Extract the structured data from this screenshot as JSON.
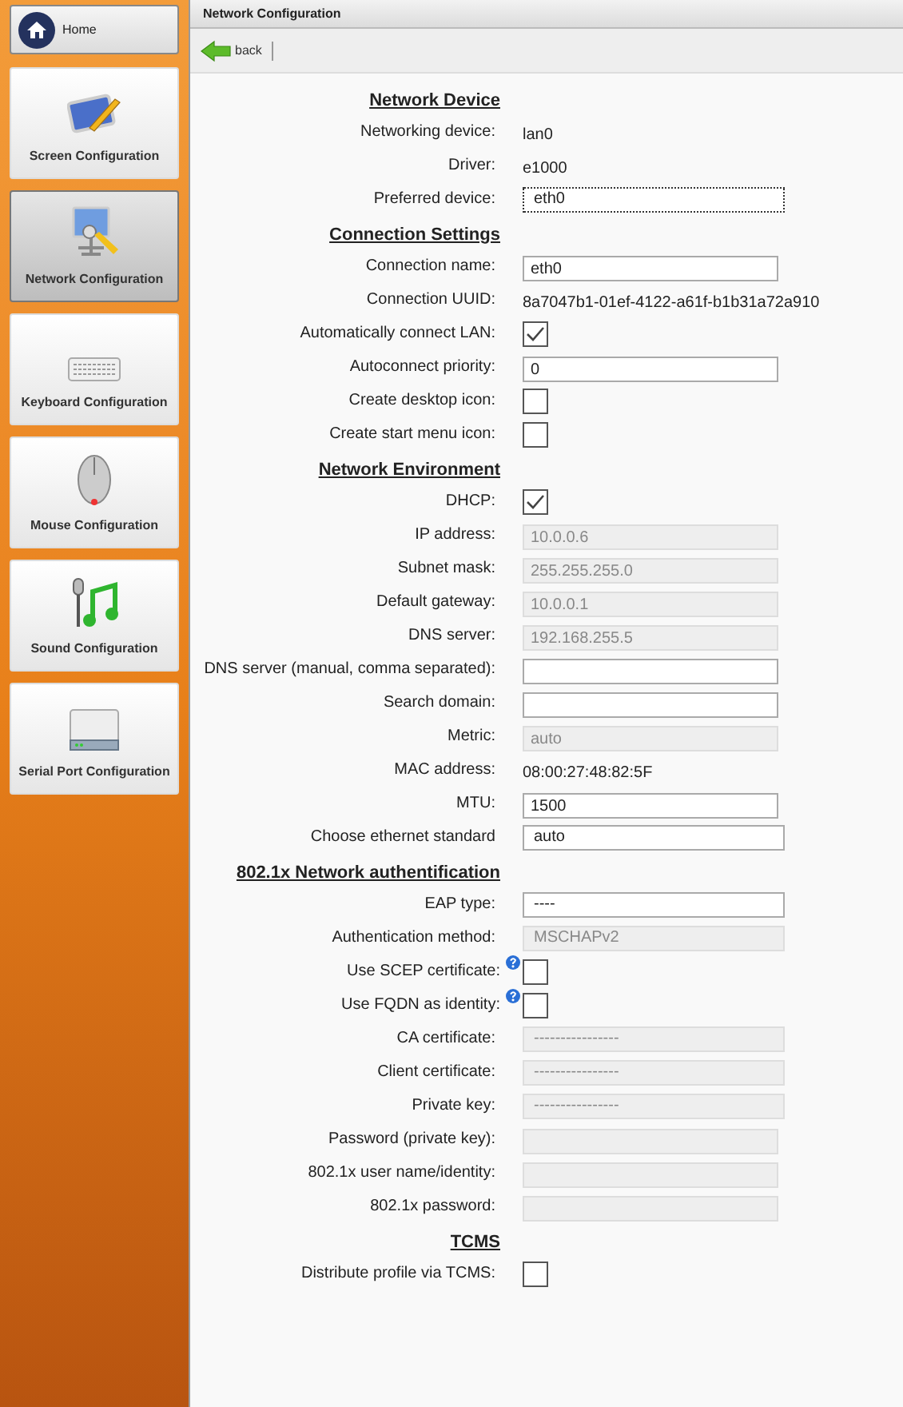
{
  "sidebar": {
    "home": {
      "label": "Home"
    },
    "items": [
      {
        "label": "Screen Configuration",
        "kind": "screen",
        "selected": false
      },
      {
        "label": "Network Configuration",
        "kind": "network",
        "selected": true
      },
      {
        "label": "Keyboard Configuration",
        "kind": "keyboard",
        "selected": false
      },
      {
        "label": "Mouse Configuration",
        "kind": "mouse",
        "selected": false
      },
      {
        "label": "Sound Configuration",
        "kind": "sound",
        "selected": false
      },
      {
        "label": "Serial Port Configuration",
        "kind": "serial",
        "selected": false
      }
    ]
  },
  "window": {
    "title": "Network Configuration"
  },
  "toolbar": {
    "back": "back"
  },
  "form": [
    {
      "kind": "heading",
      "label": "Network Device"
    },
    {
      "kind": "text",
      "label": "Networking device:",
      "value": "lan0"
    },
    {
      "kind": "text",
      "label": "Driver:",
      "value": "e1000"
    },
    {
      "kind": "select",
      "label": "Preferred device:",
      "value": "eth0",
      "disabled": false,
      "focused": true
    },
    {
      "kind": "heading",
      "label": "Connection Settings"
    },
    {
      "kind": "input",
      "label": "Connection name:",
      "value": "eth0",
      "disabled": false
    },
    {
      "kind": "text",
      "label": "Connection UUID:",
      "value": "8a7047b1-01ef-4122-a61f-b1b31a72a910"
    },
    {
      "kind": "checkbox",
      "label": "Automatically connect LAN:",
      "checked": true
    },
    {
      "kind": "input",
      "label": "Autoconnect priority:",
      "value": "0",
      "disabled": false
    },
    {
      "kind": "checkbox",
      "label": "Create desktop icon:",
      "checked": false
    },
    {
      "kind": "checkbox",
      "label": "Create start menu icon:",
      "checked": false
    },
    {
      "kind": "heading",
      "label": "Network Environment"
    },
    {
      "kind": "checkbox",
      "label": "DHCP:",
      "checked": true
    },
    {
      "kind": "input",
      "label": "IP address:",
      "value": "10.0.0.6",
      "disabled": true
    },
    {
      "kind": "input",
      "label": "Subnet mask:",
      "value": "255.255.255.0",
      "disabled": true
    },
    {
      "kind": "input",
      "label": "Default gateway:",
      "value": "10.0.0.1",
      "disabled": true
    },
    {
      "kind": "input",
      "label": "DNS server:",
      "value": "192.168.255.5",
      "disabled": true
    },
    {
      "kind": "input",
      "label": "DNS server (manual, comma separated):",
      "disabled": false
    },
    {
      "kind": "input",
      "label": "Search domain:",
      "disabled": false
    },
    {
      "kind": "input",
      "label": "Metric:",
      "value": "auto",
      "disabled": true
    },
    {
      "kind": "text",
      "label": "MAC address:",
      "value": "08:00:27:48:82:5F"
    },
    {
      "kind": "input",
      "label": "MTU:",
      "value": "1500",
      "disabled": false
    },
    {
      "kind": "select",
      "label": "Choose ethernet standard",
      "value": "auto",
      "disabled": false
    },
    {
      "kind": "heading",
      "label": "802.1x Network authentification"
    },
    {
      "kind": "select",
      "label": "EAP type:",
      "value": "----",
      "disabled": false
    },
    {
      "kind": "select",
      "label": "Authentication method:",
      "value": "MSCHAPv2",
      "disabled": true
    },
    {
      "kind": "checkbox",
      "label": "Use SCEP certificate:",
      "checked": false,
      "help": true
    },
    {
      "kind": "checkbox",
      "label": "Use FQDN as identity:",
      "checked": false,
      "help": true
    },
    {
      "kind": "select",
      "label": "CA certificate:",
      "value": "----------------",
      "disabled": true
    },
    {
      "kind": "select",
      "label": "Client certificate:",
      "value": "----------------",
      "disabled": true
    },
    {
      "kind": "select",
      "label": "Private key:",
      "value": "----------------",
      "disabled": true
    },
    {
      "kind": "input",
      "label": "Password (private key):",
      "disabled": true
    },
    {
      "kind": "input",
      "label": "802.1x user name/identity:",
      "disabled": true
    },
    {
      "kind": "input",
      "label": "802.1x password:",
      "disabled": true
    },
    {
      "kind": "heading",
      "label": "TCMS"
    },
    {
      "kind": "checkbox",
      "label": "Distribute profile via TCMS:",
      "checked": false
    }
  ]
}
